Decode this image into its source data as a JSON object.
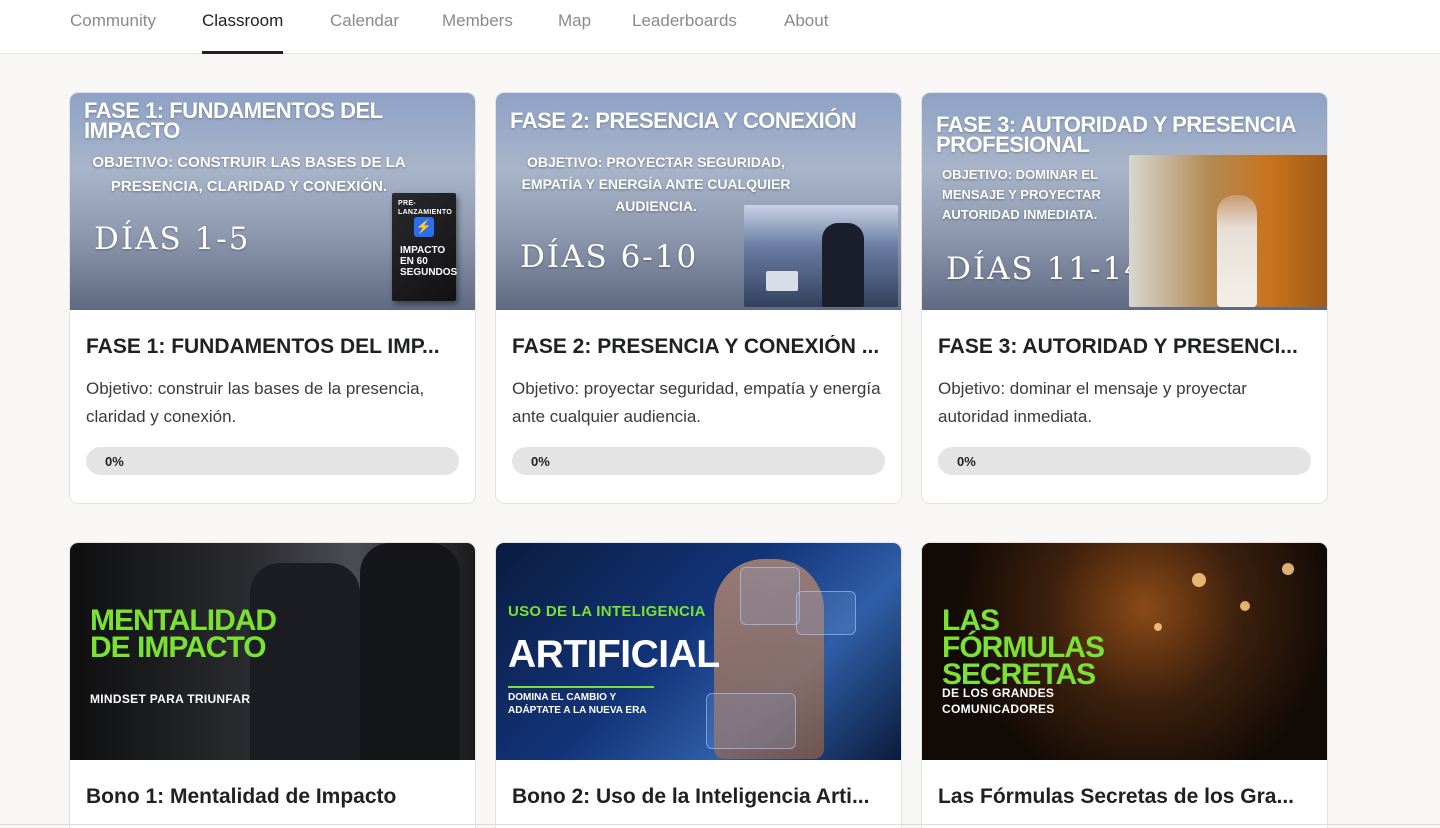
{
  "nav": {
    "tabs": [
      {
        "label": "Community",
        "active": false
      },
      {
        "label": "Classroom",
        "active": true
      },
      {
        "label": "Calendar",
        "active": false
      },
      {
        "label": "Members",
        "active": false
      },
      {
        "label": "Map",
        "active": false
      },
      {
        "label": "Leaderboards",
        "active": false
      },
      {
        "label": "About",
        "active": false
      }
    ]
  },
  "courses": [
    {
      "title": "FASE 1: FUNDAMENTOS DEL IMP...",
      "description": "Objetivo: construir las bases de la presencia, claridad y conexión.",
      "progress_label": "0%",
      "progress": 0,
      "image": {
        "heading": "FASE 1: FUNDAMENTOS DEL IMPACTO",
        "objective": "OBJETIVO: CONSTRUIR LAS BASES DE LA PRESENCIA, CLARIDAD Y CONEXIÓN.",
        "days": "DÍAS 1-5",
        "book_tag": "PRE-LANZAMIENTO",
        "book_title": "IMPACTO EN 60 SEGUNDOS"
      }
    },
    {
      "title": "FASE 2: PRESENCIA Y CONEXIÓN ...",
      "description": "Objetivo: proyectar seguridad, empatía y energía ante cualquier audiencia.",
      "progress_label": "0%",
      "progress": 0,
      "image": {
        "heading": "FASE 2: PRESENCIA Y CONEXIÓN",
        "objective": "OBJETIVO: PROYECTAR SEGURIDAD, EMPATÍA Y ENERGÍA ANTE CUALQUIER AUDIENCIA.",
        "days": "DÍAS 6-10"
      }
    },
    {
      "title": "FASE 3: AUTORIDAD Y PRESENCI...",
      "description": "Objetivo: dominar el mensaje y proyectar autoridad inmediata.",
      "progress_label": "0%",
      "progress": 0,
      "image": {
        "heading": "FASE 3: AUTORIDAD Y PRESENCIA PROFESIONAL",
        "objective": "OBJETIVO: DOMINAR EL MENSAJE Y PROYECTAR AUTORIDAD INMEDIATA.",
        "days": "DÍAS 11-14"
      }
    },
    {
      "title": "Bono 1: Mentalidad de Impacto",
      "image": {
        "heading": "MENTALIDAD DE IMPACTO",
        "subheading": "MINDSET PARA TRIUNFAR"
      }
    },
    {
      "title": "Bono 2: Uso de la Inteligencia Arti...",
      "image": {
        "kicker": "USO DE LA INTELIGENCIA",
        "heading": "ARTIFICIAL",
        "subheading": "DOMINA EL CAMBIO Y ADÁPTATE A LA NUEVA ERA"
      }
    },
    {
      "title": "Las Fórmulas Secretas de los Gra...",
      "image": {
        "heading": "LAS FÓRMULAS SECRETAS",
        "subheading": "DE LOS GRANDES COMUNICADORES"
      }
    }
  ],
  "colors": {
    "accent_green": "#7be132",
    "progress_track": "#e4e4e4",
    "text_primary": "#202124",
    "tab_inactive": "#8a8a8a"
  }
}
